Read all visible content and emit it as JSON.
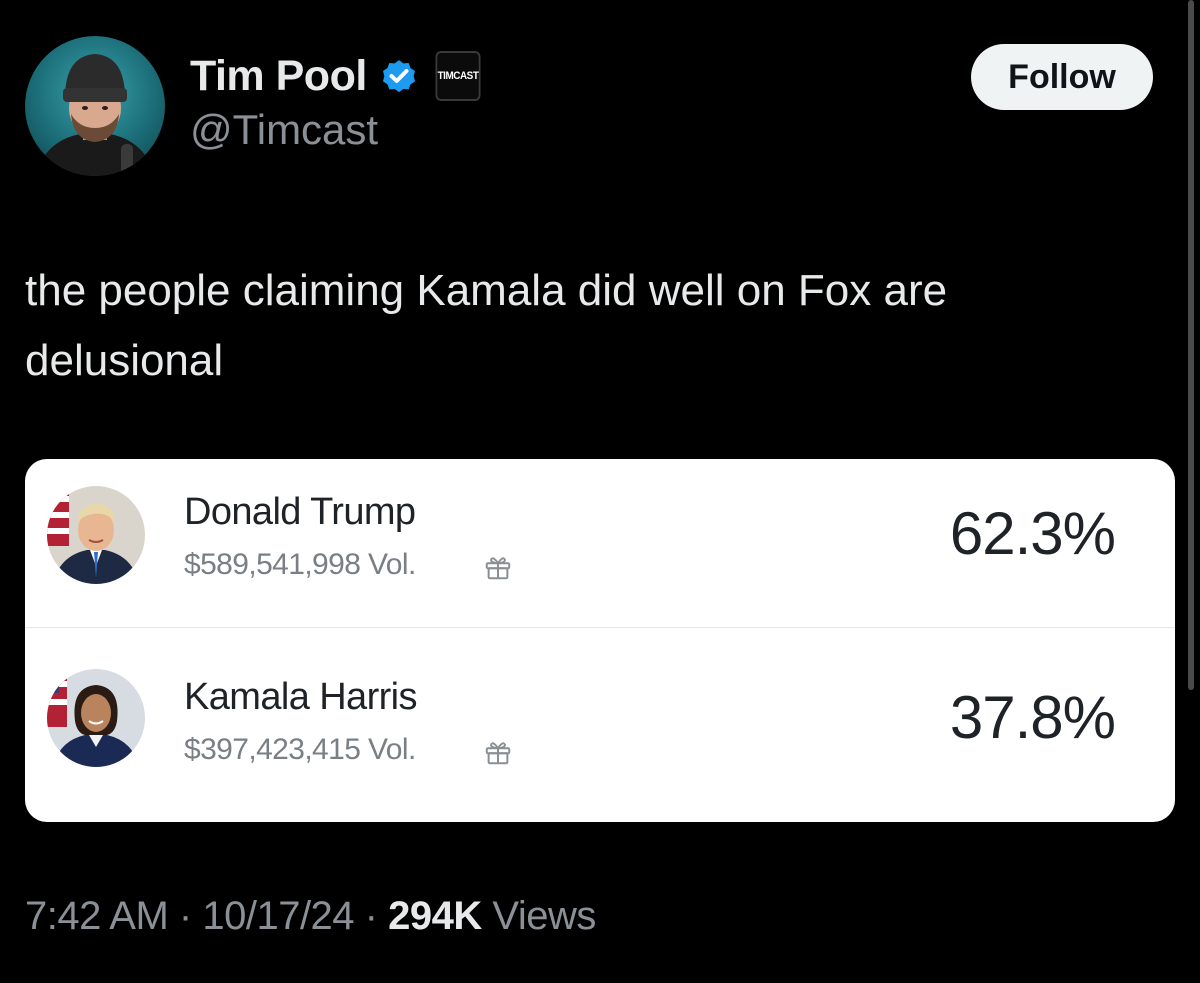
{
  "author": {
    "display_name": "Tim Pool",
    "handle": "@Timcast",
    "affiliate_badge": "TIMCAST",
    "verified_color": "#1d9bf0"
  },
  "follow_label": "Follow",
  "tweet_text": "the people claiming Kamala did well on Fox are delusional",
  "market": {
    "candidates": [
      {
        "name": "Donald Trump",
        "volume": "$589,541,998 Vol.",
        "percent": "62.3%"
      },
      {
        "name": "Kamala Harris",
        "volume": "$397,423,415 Vol.",
        "percent": "37.8%"
      }
    ]
  },
  "meta": {
    "time": "7:42 AM",
    "separator": "·",
    "date": "10/17/24",
    "views_count": "294K",
    "views_label": "Views"
  }
}
